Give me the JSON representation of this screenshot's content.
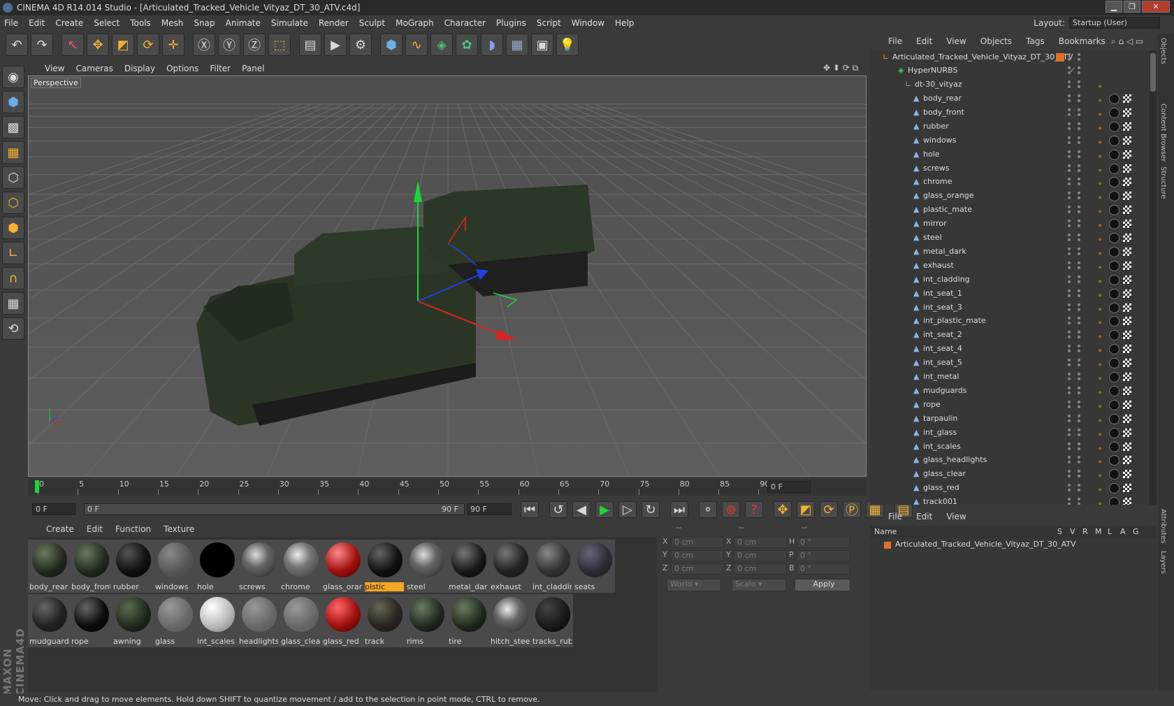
{
  "window": {
    "title": "CINEMA 4D R14.014 Studio - [Articulated_Tracked_Vehicle_Vityaz_DT_30_ATV.c4d]",
    "minimize": "▁",
    "maximize": "❐",
    "close": "✕"
  },
  "menu": [
    "File",
    "Edit",
    "Create",
    "Select",
    "Tools",
    "Mesh",
    "Snap",
    "Animate",
    "Simulate",
    "Render",
    "Sculpt",
    "MoGraph",
    "Character",
    "Plugins",
    "Script",
    "Window",
    "Help"
  ],
  "layout": {
    "label": "Layout:",
    "value": "Startup (User)"
  },
  "viewport": {
    "menu": [
      "View",
      "Cameras",
      "Display",
      "Options",
      "Filter",
      "Panel"
    ],
    "camera_label": "Perspective"
  },
  "timeline": {
    "ticks": [
      "0",
      "5",
      "10",
      "15",
      "20",
      "25",
      "30",
      "35",
      "40",
      "45",
      "50",
      "55",
      "60",
      "65",
      "70",
      "75",
      "80",
      "85",
      "90"
    ],
    "current_frame": "0 F",
    "start_field": "0 F",
    "range_start": "0 F",
    "range_end": "90 F",
    "end_field": "90 F"
  },
  "material_manager": {
    "menu": [
      "Create",
      "Edit",
      "Function",
      "Texture"
    ],
    "row1": [
      "body_rear",
      "body_front",
      "rubber",
      "windows",
      "hole",
      "screws",
      "chrome",
      "glass_oran",
      "plstic",
      "steel",
      "metal_dark",
      "exhaust",
      "int_claddin",
      "seats"
    ],
    "row2": [
      "mudguards",
      "rope",
      "awning",
      "glass",
      "int_scales",
      "headlights",
      "glass_clear",
      "glass_red",
      "track",
      "rims",
      "tire",
      "hitch_steel",
      "tracks_rubl"
    ],
    "selected": "plstic"
  },
  "attributes": {
    "headers": [
      "--",
      "--",
      "--"
    ],
    "rows": [
      {
        "a": "X",
        "av": "0 cm",
        "b": "X",
        "bv": "0 cm",
        "c": "H",
        "cv": "0 °"
      },
      {
        "a": "Y",
        "av": "0 cm",
        "b": "Y",
        "bv": "0 cm",
        "c": "P",
        "cv": "0 °"
      },
      {
        "a": "Z",
        "av": "0 cm",
        "b": "Z",
        "bv": "0 cm",
        "c": "B",
        "cv": "0 °"
      }
    ],
    "coord_mode": "World",
    "size_mode": "Scale",
    "apply": "Apply"
  },
  "object_manager": {
    "menu": [
      "File",
      "Edit",
      "View",
      "Objects",
      "Tags",
      "Bookmarks"
    ],
    "root": "Articulated_Tracked_Vehicle_Vityaz_DT_30_ATV",
    "hypernurbs": "HyperNURBS",
    "group": "dt-30_vityaz",
    "children": [
      "body_rear",
      "body_front",
      "rubber",
      "windows",
      "hole",
      "screws",
      "chrome",
      "glass_orange",
      "plastic_mate",
      "mirror",
      "steel",
      "metal_dark",
      "exhaust",
      "int_cladding",
      "int_seat_1",
      "int_seat_3",
      "int_plastic_mate",
      "int_seat_2",
      "int_seat_4",
      "int_seat_5",
      "int_metal",
      "mudguards",
      "rope",
      "tarpaulin",
      "int_glass",
      "int_scales",
      "glass_headlights",
      "glass_clear",
      "glass_red",
      "track001"
    ]
  },
  "layer_manager": {
    "menu": [
      "File",
      "Edit",
      "View"
    ],
    "columns": [
      "Name",
      "S",
      "V",
      "R",
      "M",
      "L",
      "A",
      "G"
    ],
    "layer": "Articulated_Tracked_Vehicle_Vityaz_DT_30_ATV"
  },
  "right_tabs": [
    "Objects",
    "Content Browser",
    "Structure",
    "Attributes",
    "Layers"
  ],
  "brand": "MAXON CINEMA4D",
  "status": "Move: Click and drag to move elements. Hold down SHIFT to quantize movement / add to the selection in point mode, CTRL to remove."
}
